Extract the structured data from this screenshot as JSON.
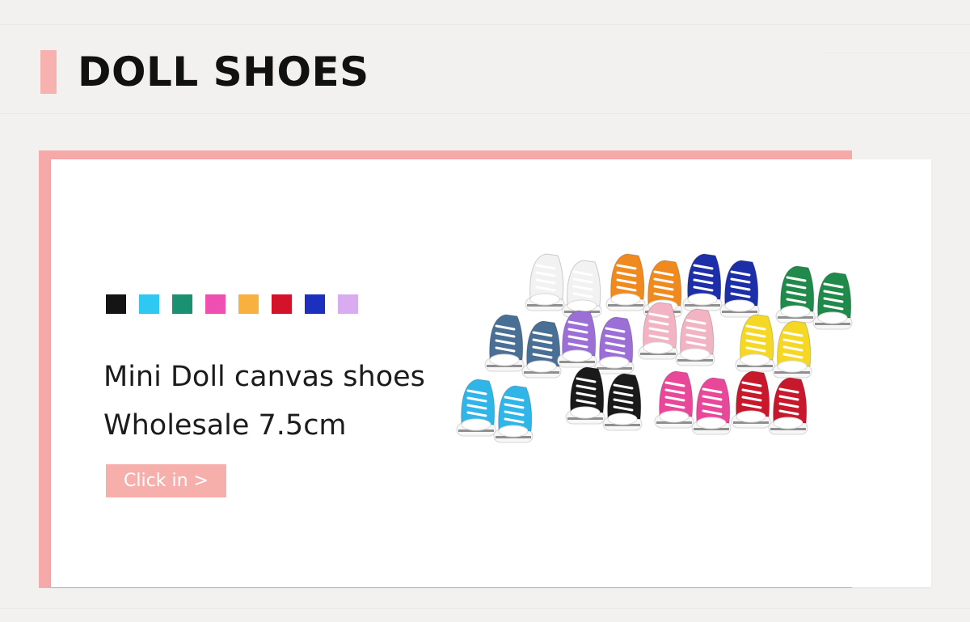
{
  "section": {
    "title": "DOLL SHOES"
  },
  "product": {
    "swatch_colors": [
      "#141414",
      "#2ec8f0",
      "#1a9272",
      "#ef4fb1",
      "#f8b03f",
      "#d4132b",
      "#1d2fbf",
      "#d9acf2"
    ],
    "headline_line1": "Mini Doll canvas shoes",
    "headline_line2": "Wholesale 7.5cm",
    "cta_label": "Click in >"
  },
  "colors": {
    "accent_pink": "#f7b1ae",
    "frame_pink": "#f5a9a8",
    "background": "#f2f1f0",
    "card": "#ffffff"
  },
  "image": {
    "subject": "pairs of mini canvas sneakers",
    "shoe_colors": [
      "#f2f2f2",
      "#f08a1e",
      "#1d2fa8",
      "#1f8a4a",
      "#4a6f95",
      "#9b6fd6",
      "#f2b3c3",
      "#f4d823",
      "#2fb5e8",
      "#1a1a1a",
      "#e9489a",
      "#c8182c"
    ]
  }
}
